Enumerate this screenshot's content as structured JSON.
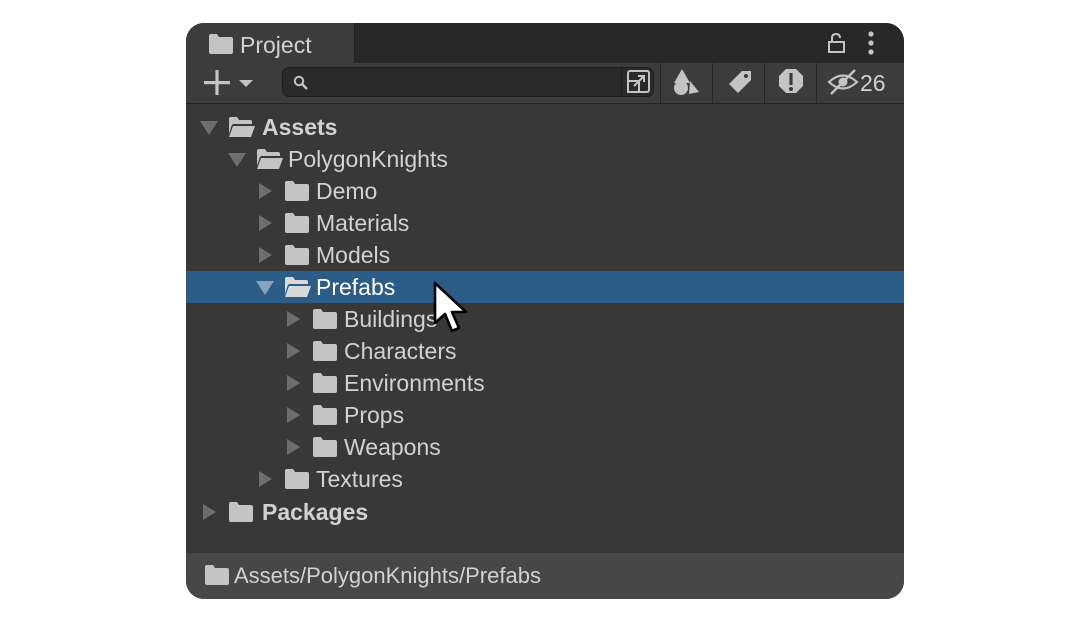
{
  "window": {
    "tab_label": "Project",
    "icons": [
      "folder-icon",
      "lock-icon",
      "more-vertical-icon"
    ]
  },
  "toolbar": {
    "create_icon": "plus-icon",
    "search": {
      "value": "",
      "placeholder": ""
    },
    "buttons": [
      "scene-search-icon",
      "filter-by-type-icon",
      "filter-by-label-icon",
      "filter-by-warning-icon",
      "hidden-packages-icon"
    ],
    "hidden_count": "26"
  },
  "tree": {
    "items": [
      {
        "label": "Assets",
        "bold": true,
        "expanded": true
      },
      {
        "label": "PolygonKnights",
        "expanded": true
      },
      {
        "label": "Demo",
        "expanded": false
      },
      {
        "label": "Materials",
        "expanded": false
      },
      {
        "label": "Models",
        "expanded": false
      },
      {
        "label": "Prefabs",
        "expanded": true,
        "selected": true
      },
      {
        "label": "Buildings",
        "expanded": false
      },
      {
        "label": "Characters",
        "expanded": false
      },
      {
        "label": "Environments",
        "expanded": false
      },
      {
        "label": "Props",
        "expanded": false
      },
      {
        "label": "Weapons",
        "expanded": false
      },
      {
        "label": "Textures",
        "expanded": false
      },
      {
        "label": "Packages",
        "bold": true,
        "expanded": false
      }
    ]
  },
  "status": {
    "path": "Assets/PolygonKnights/Prefabs"
  },
  "colors": {
    "panel": "#383838",
    "selection": "#2c5d87",
    "text": "#d2d2d2"
  }
}
